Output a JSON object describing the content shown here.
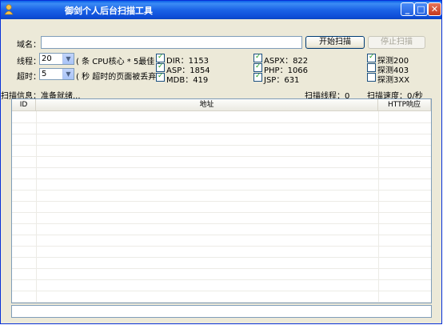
{
  "window": {
    "title": "御剑个人后台扫描工具"
  },
  "form": {
    "domain_label": "域名：",
    "domain_value": "",
    "threads_label": "线程：",
    "threads_value": "20",
    "threads_hint": "( 条 CPU核心 * 5最佳 )",
    "timeout_label": "超时：",
    "timeout_value": "5",
    "timeout_hint": "( 秒 超时的页面被丢弃 )"
  },
  "buttons": {
    "start": "开始扫描",
    "stop": "停止扫描"
  },
  "dicts": [
    {
      "label": "DIR：1153",
      "checked": true
    },
    {
      "label": "ASP：1854",
      "checked": true
    },
    {
      "label": "MDB：419",
      "checked": true
    },
    {
      "label": "ASPX：822",
      "checked": true
    },
    {
      "label": "PHP：1066",
      "checked": true
    },
    {
      "label": "JSP：631",
      "checked": true
    }
  ],
  "probes": [
    {
      "label": "探测200",
      "checked": true
    },
    {
      "label": "探测403",
      "checked": false
    },
    {
      "label": "探测3XX",
      "checked": false
    }
  ],
  "status_line": {
    "info": "扫描信息：准备就绪...",
    "threads": "扫描线程：0",
    "speed": "扫描速度：0/秒"
  },
  "table": {
    "columns": [
      "ID",
      "地址",
      "HTTP响应"
    ]
  }
}
